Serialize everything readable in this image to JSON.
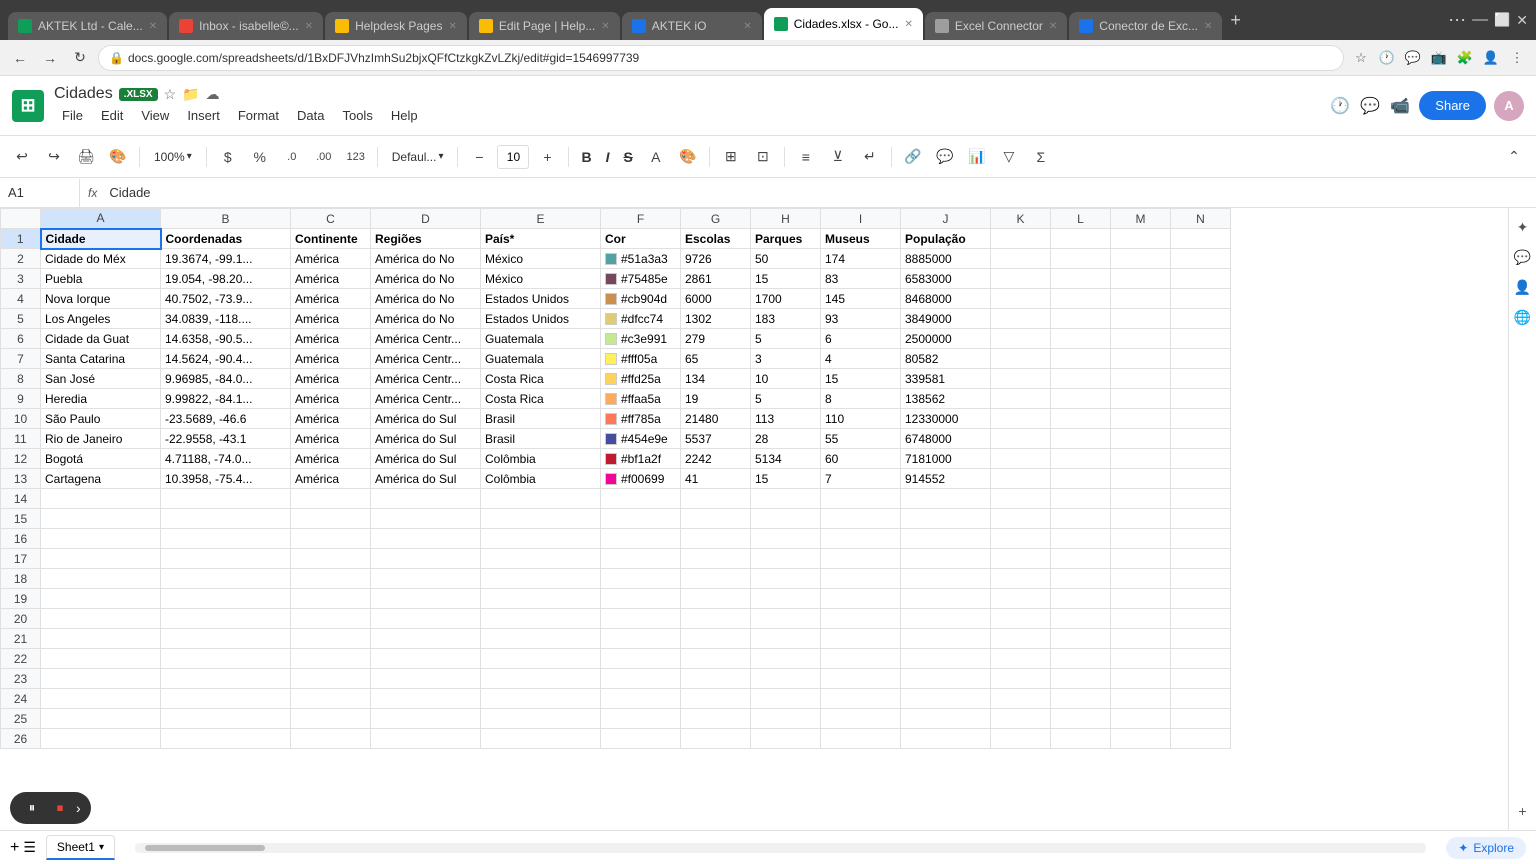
{
  "browser": {
    "tabs": [
      {
        "id": "t1",
        "label": "AKTEK Ltd - Cale...",
        "favicon_color": "#0f9d58",
        "active": false
      },
      {
        "id": "t2",
        "label": "Inbox - isabelle©...",
        "favicon_color": "#ea4335",
        "active": false
      },
      {
        "id": "t3",
        "label": "Helpdesk Pages",
        "favicon_color": "#fbbc04",
        "active": false
      },
      {
        "id": "t4",
        "label": "Edit Page | Help...",
        "favicon_color": "#fbbc04",
        "active": false
      },
      {
        "id": "t5",
        "label": "AKTEK iO",
        "favicon_color": "#1a73e8",
        "active": false
      },
      {
        "id": "t6",
        "label": "Cidades.xlsx - Go...",
        "favicon_color": "#0f9d58",
        "active": true
      },
      {
        "id": "t7",
        "label": "Excel Connector",
        "favicon_color": "#9e9e9e",
        "active": false
      },
      {
        "id": "t8",
        "label": "Conector de Exc...",
        "favicon_color": "#1a73e8",
        "active": false
      }
    ],
    "address": "docs.google.com/spreadsheets/d/1BxDFJVhzImhSu2bjxQFfCtzkgkZvLZkj/edit#gid=1546997739"
  },
  "app": {
    "logo_letter": "S",
    "title": "Cidades",
    "badge": ".XLSX",
    "menu_items": [
      "File",
      "Edit",
      "View",
      "Insert",
      "Format",
      "Data",
      "Tools",
      "Help"
    ],
    "share_label": "Share"
  },
  "toolbar": {
    "zoom": "100%",
    "currency": "$",
    "percent": "%",
    "decimal_decrease": ".0",
    "decimal_increase": ".00",
    "format_123": "123",
    "font_family": "Defaul...",
    "font_size": "10",
    "bold": "B",
    "italic": "I",
    "strikethrough": "S"
  },
  "formula_bar": {
    "cell_ref": "A1",
    "formula": "Cidade"
  },
  "columns": [
    "A",
    "B",
    "C",
    "D",
    "E",
    "F",
    "G",
    "H",
    "I",
    "J",
    "K",
    "L",
    "M",
    "N"
  ],
  "rows": [
    {
      "num": 1,
      "cells": [
        "Cidade",
        "Coordenadas",
        "Continente",
        "Regiões",
        "País*",
        "Cor",
        "Escolas",
        "Parques",
        "Museus",
        "População",
        "",
        "",
        "",
        ""
      ]
    },
    {
      "num": 2,
      "cells": [
        "Cidade do Méx",
        "19.3674, -99.1...",
        "América",
        "América do No",
        "México",
        "#51a3a3",
        "9726",
        "50",
        "174",
        "8885000",
        "",
        "",
        "",
        ""
      ]
    },
    {
      "num": 3,
      "cells": [
        "Puebla",
        "19.054, -98.20...",
        "América",
        "América do No",
        "México",
        "#75485e",
        "2861",
        "15",
        "83",
        "6583000",
        "",
        "",
        "",
        ""
      ]
    },
    {
      "num": 4,
      "cells": [
        "Nova Iorque",
        "40.7502, -73.9...",
        "América",
        "América do No",
        "Estados Unidos",
        "#cb904d",
        "6000",
        "1700",
        "145",
        "8468000",
        "",
        "",
        "",
        ""
      ]
    },
    {
      "num": 5,
      "cells": [
        "Los Angeles",
        "34.0839, -118....",
        "América",
        "América do No",
        "Estados Unidos",
        "#dfcc74",
        "1302",
        "183",
        "93",
        "3849000",
        "",
        "",
        "",
        ""
      ]
    },
    {
      "num": 6,
      "cells": [
        "Cidade da Guat",
        "14.6358, -90.5...",
        "América",
        "América Centr...",
        "Guatemala",
        "#c3e991",
        "279",
        "5",
        "6",
        "2500000",
        "",
        "",
        "",
        ""
      ]
    },
    {
      "num": 7,
      "cells": [
        "Santa Catarina",
        "14.5624, -90.4...",
        "América",
        "América Centr...",
        "Guatemala",
        "#fff05a",
        "65",
        "3",
        "4",
        "80582",
        "",
        "",
        "",
        ""
      ]
    },
    {
      "num": 8,
      "cells": [
        "San José",
        "9.96985, -84.0...",
        "América",
        "América Centr...",
        "Costa Rica",
        "#ffd25a",
        "134",
        "10",
        "15",
        "339581",
        "",
        "",
        "",
        ""
      ]
    },
    {
      "num": 9,
      "cells": [
        "Heredia",
        "9.99822, -84.1...",
        "América",
        "América Centr...",
        "Costa Rica",
        "#ffaa5a",
        "19",
        "5",
        "8",
        "138562",
        "",
        "",
        "",
        ""
      ]
    },
    {
      "num": 10,
      "cells": [
        "São Paulo",
        "-23.5689, -46.6",
        "América",
        "América do Sul",
        "Brasil",
        "#ff785a",
        "21480",
        "113",
        "110",
        "12330000",
        "",
        "",
        "",
        ""
      ]
    },
    {
      "num": 11,
      "cells": [
        "Rio de Janeiro",
        "-22.9558, -43.1",
        "América",
        "América do Sul",
        "Brasil",
        "#454e9e",
        "5537",
        "28",
        "55",
        "6748000",
        "",
        "",
        "",
        ""
      ]
    },
    {
      "num": 12,
      "cells": [
        "Bogotá",
        "4.71188, -74.0...",
        "América",
        "América do Sul",
        "Colômbia",
        "#bf1a2f",
        "2242",
        "5134",
        "60",
        "7181000",
        "",
        "",
        "",
        ""
      ]
    },
    {
      "num": 13,
      "cells": [
        "Cartagena",
        "10.3958, -75.4...",
        "América",
        "América do Sul",
        "Colômbia",
        "#f00699",
        "41",
        "15",
        "7",
        "914552",
        "",
        "",
        "",
        ""
      ]
    },
    {
      "num": 14,
      "cells": [
        "",
        "",
        "",
        "",
        "",
        "",
        "",
        "",
        "",
        "",
        "",
        "",
        "",
        ""
      ]
    },
    {
      "num": 15,
      "cells": [
        "",
        "",
        "",
        "",
        "",
        "",
        "",
        "",
        "",
        "",
        "",
        "",
        "",
        ""
      ]
    },
    {
      "num": 16,
      "cells": [
        "",
        "",
        "",
        "",
        "",
        "",
        "",
        "",
        "",
        "",
        "",
        "",
        "",
        ""
      ]
    },
    {
      "num": 17,
      "cells": [
        "",
        "",
        "",
        "",
        "",
        "",
        "",
        "",
        "",
        "",
        "",
        "",
        "",
        ""
      ]
    },
    {
      "num": 18,
      "cells": [
        "",
        "",
        "",
        "",
        "",
        "",
        "",
        "",
        "",
        "",
        "",
        "",
        "",
        ""
      ]
    },
    {
      "num": 19,
      "cells": [
        "",
        "",
        "",
        "",
        "",
        "",
        "",
        "",
        "",
        "",
        "",
        "",
        "",
        ""
      ]
    },
    {
      "num": 20,
      "cells": [
        "",
        "",
        "",
        "",
        "",
        "",
        "",
        "",
        "",
        "",
        "",
        "",
        "",
        ""
      ]
    },
    {
      "num": 21,
      "cells": [
        "",
        "",
        "",
        "",
        "",
        "",
        "",
        "",
        "",
        "",
        "",
        "",
        "",
        ""
      ]
    },
    {
      "num": 22,
      "cells": [
        "",
        "",
        "",
        "",
        "",
        "",
        "",
        "",
        "",
        "",
        "",
        "",
        "",
        ""
      ]
    },
    {
      "num": 23,
      "cells": [
        "",
        "",
        "",
        "",
        "",
        "",
        "",
        "",
        "",
        "",
        "",
        "",
        "",
        ""
      ]
    },
    {
      "num": 24,
      "cells": [
        "",
        "",
        "",
        "",
        "",
        "",
        "",
        "",
        "",
        "",
        "",
        "",
        "",
        ""
      ]
    },
    {
      "num": 25,
      "cells": [
        "",
        "",
        "",
        "",
        "",
        "",
        "",
        "",
        "",
        "",
        "",
        "",
        "",
        ""
      ]
    },
    {
      "num": 26,
      "cells": [
        "",
        "",
        "",
        "",
        "",
        "",
        "",
        "",
        "",
        "",
        "",
        "",
        "",
        ""
      ]
    }
  ],
  "sheet_tab": "Sheet1",
  "explore_label": "Explore"
}
